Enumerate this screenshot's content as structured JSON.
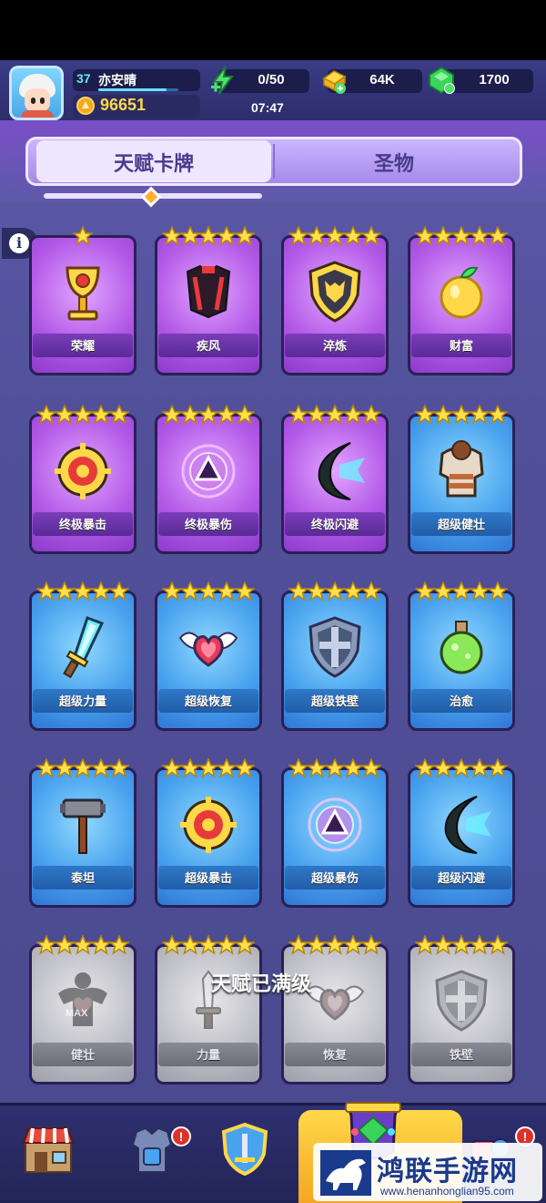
{
  "hud": {
    "level": "37",
    "player_name": "亦安晴",
    "xp_progress": 0.85,
    "coins": "96651",
    "energy": "0/50",
    "gold": "64K",
    "gems": "1700",
    "timer": "07:47"
  },
  "tabs": [
    {
      "label": "天赋卡牌",
      "active": true
    },
    {
      "label": "圣物",
      "active": false
    }
  ],
  "cards": [
    {
      "name": "荣耀",
      "stars": 1,
      "tier": "purple",
      "icon": "golden-chalice-icon"
    },
    {
      "name": "疾风",
      "stars": 5,
      "tier": "purple",
      "icon": "cape-icon"
    },
    {
      "name": "淬炼",
      "stars": 5,
      "tier": "purple",
      "icon": "fox-shield-icon"
    },
    {
      "name": "财富",
      "stars": 5,
      "tier": "purple",
      "icon": "golden-fruit-icon"
    },
    {
      "name": "终极暴击",
      "stars": 5,
      "tier": "purple",
      "icon": "crosshair-icon"
    },
    {
      "name": "终极暴伤",
      "stars": 5,
      "tier": "purple",
      "icon": "triangle-rune-icon"
    },
    {
      "name": "终极闪避",
      "stars": 5,
      "tier": "purple",
      "icon": "dodge-arc-icon"
    },
    {
      "name": "超级健壮",
      "stars": 5,
      "tier": "blue",
      "icon": "armor-icon"
    },
    {
      "name": "超级力量",
      "stars": 5,
      "tier": "blue",
      "icon": "crystal-sword-icon"
    },
    {
      "name": "超级恢复",
      "stars": 5,
      "tier": "blue",
      "icon": "winged-heart-icon"
    },
    {
      "name": "超级铁壁",
      "stars": 5,
      "tier": "blue",
      "icon": "cross-shield-icon"
    },
    {
      "name": "治愈",
      "stars": 5,
      "tier": "blue",
      "icon": "potion-icon"
    },
    {
      "name": "泰坦",
      "stars": 5,
      "tier": "blue",
      "icon": "hammer-icon"
    },
    {
      "name": "超级暴击",
      "stars": 5,
      "tier": "blue",
      "icon": "crosshair-icon"
    },
    {
      "name": "超级暴伤",
      "stars": 5,
      "tier": "blue",
      "icon": "triangle-rune-icon"
    },
    {
      "name": "超级闪避",
      "stars": 5,
      "tier": "blue",
      "icon": "dodge-arc-icon"
    },
    {
      "name": "健壮",
      "stars": 5,
      "tier": "grey",
      "icon": "muscle-heart-icon"
    },
    {
      "name": "力量",
      "stars": 5,
      "tier": "grey",
      "icon": "dagger-icon"
    },
    {
      "name": "恢复",
      "stars": 5,
      "tier": "grey",
      "icon": "winged-heart-icon"
    },
    {
      "name": "铁壁",
      "stars": 5,
      "tier": "grey",
      "icon": "cross-shield-icon"
    }
  ],
  "maxed_text": "天赋已满级",
  "grey_card_art_text": "MAX",
  "nav": [
    {
      "icon": "shop-icon",
      "badge": ""
    },
    {
      "icon": "equipment-armor-icon",
      "badge": "!"
    },
    {
      "icon": "shield-sword-icon",
      "badge": ""
    },
    {
      "icon": "talent-gem-icon",
      "badge": "",
      "active": true
    },
    {
      "icon": "more-icon",
      "badge": "!"
    }
  ],
  "watermark": {
    "title": "鸿联手游网",
    "url": "www.henanhonglian95.com"
  },
  "colors": {
    "accent_gold": "#ffd84a",
    "level_cyan": "#67e3ff",
    "card_purple": "#b45be8",
    "card_blue": "#4aa3ee",
    "card_grey": "#bdbdc6",
    "tab_active": "#efe6ff"
  }
}
